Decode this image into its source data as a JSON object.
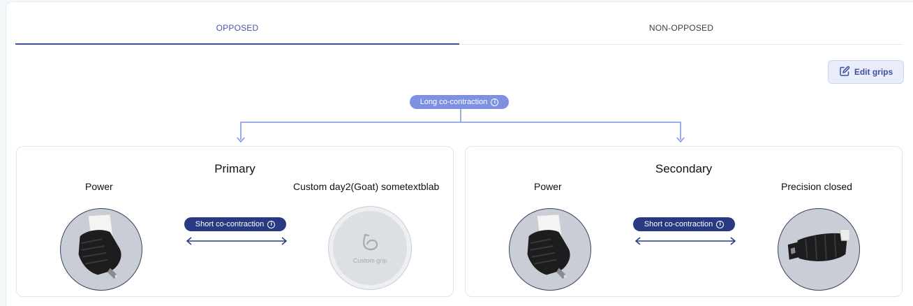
{
  "tabs": [
    {
      "label": "OPPOSED",
      "active": true
    },
    {
      "label": "NON-OPPOSED",
      "active": false
    }
  ],
  "toolbar": {
    "edit_label": "Edit grips",
    "edit_icon": "edit-icon"
  },
  "long_contraction": {
    "label": "Long co-contraction",
    "icon": "info-icon"
  },
  "primary": {
    "title": "Primary",
    "left_grip": {
      "label": "Power",
      "image": "power-grip-hand"
    },
    "right_grip": {
      "label": "Custom day2(Goat) sometextblab",
      "image_text": "Custom grip",
      "icon": "arm-flex-icon"
    },
    "short_contraction": {
      "label": "Short co-contraction",
      "icon": "info-icon"
    }
  },
  "secondary": {
    "title": "Secondary",
    "left_grip": {
      "label": "Power",
      "image": "power-grip-hand"
    },
    "right_grip": {
      "label": "Precision closed",
      "image": "precision-closed-hand"
    },
    "short_contraction": {
      "label": "Short co-contraction",
      "icon": "info-icon"
    }
  },
  "colors": {
    "accent": "#3f4f9c",
    "long_pill": "#7d90e2",
    "short_pill": "#273a82",
    "connector": "#7d90e2"
  }
}
